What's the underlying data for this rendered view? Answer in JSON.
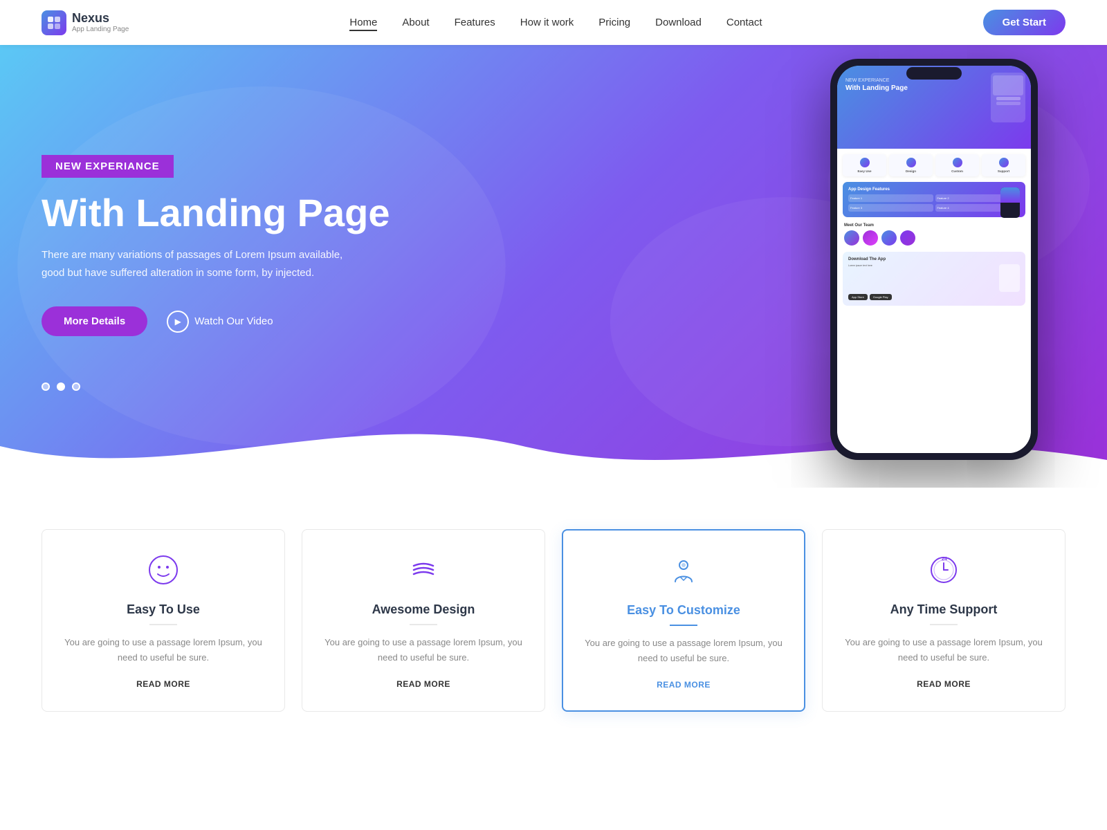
{
  "brand": {
    "name": "Nexus",
    "sub": "App Landing Page",
    "icon": "N"
  },
  "nav": {
    "links": [
      {
        "label": "Home",
        "active": true
      },
      {
        "label": "About",
        "active": false
      },
      {
        "label": "Features",
        "active": false
      },
      {
        "label": "How it work",
        "active": false
      },
      {
        "label": "Pricing",
        "active": false
      },
      {
        "label": "Download",
        "active": false
      },
      {
        "label": "Contact",
        "active": false
      }
    ],
    "cta": "Get Start"
  },
  "hero": {
    "badge": "NEW EXPERIANCE",
    "title": "With Landing Page",
    "description": "There are many variations of passages of Lorem Ipsum available, good but have suffered alteration in some form, by injected.",
    "btn_details": "More Details",
    "btn_video": "Watch Our Video",
    "dots": [
      "active",
      "active2",
      "active3"
    ]
  },
  "features": [
    {
      "icon": "☺",
      "title": "Easy To Use",
      "desc": "You are going to use a passage lorem Ipsum, you need to useful be sure.",
      "link": "READ MORE",
      "active": false
    },
    {
      "icon": "〰",
      "title": "Awesome Design",
      "desc": "You are going to use a passage lorem Ipsum, you need to useful be sure.",
      "link": "READ MORE",
      "active": false
    },
    {
      "icon": "✋",
      "title": "Easy To Customize",
      "desc": "You are going to use a passage lorem Ipsum, you need to useful be sure.",
      "link": "READ MORE",
      "active": true
    },
    {
      "icon": "⏰",
      "title": "Any Time Support",
      "desc": "You are going to use a passage lorem Ipsum, you need to useful be sure.",
      "link": "READ MORE",
      "active": false
    }
  ]
}
